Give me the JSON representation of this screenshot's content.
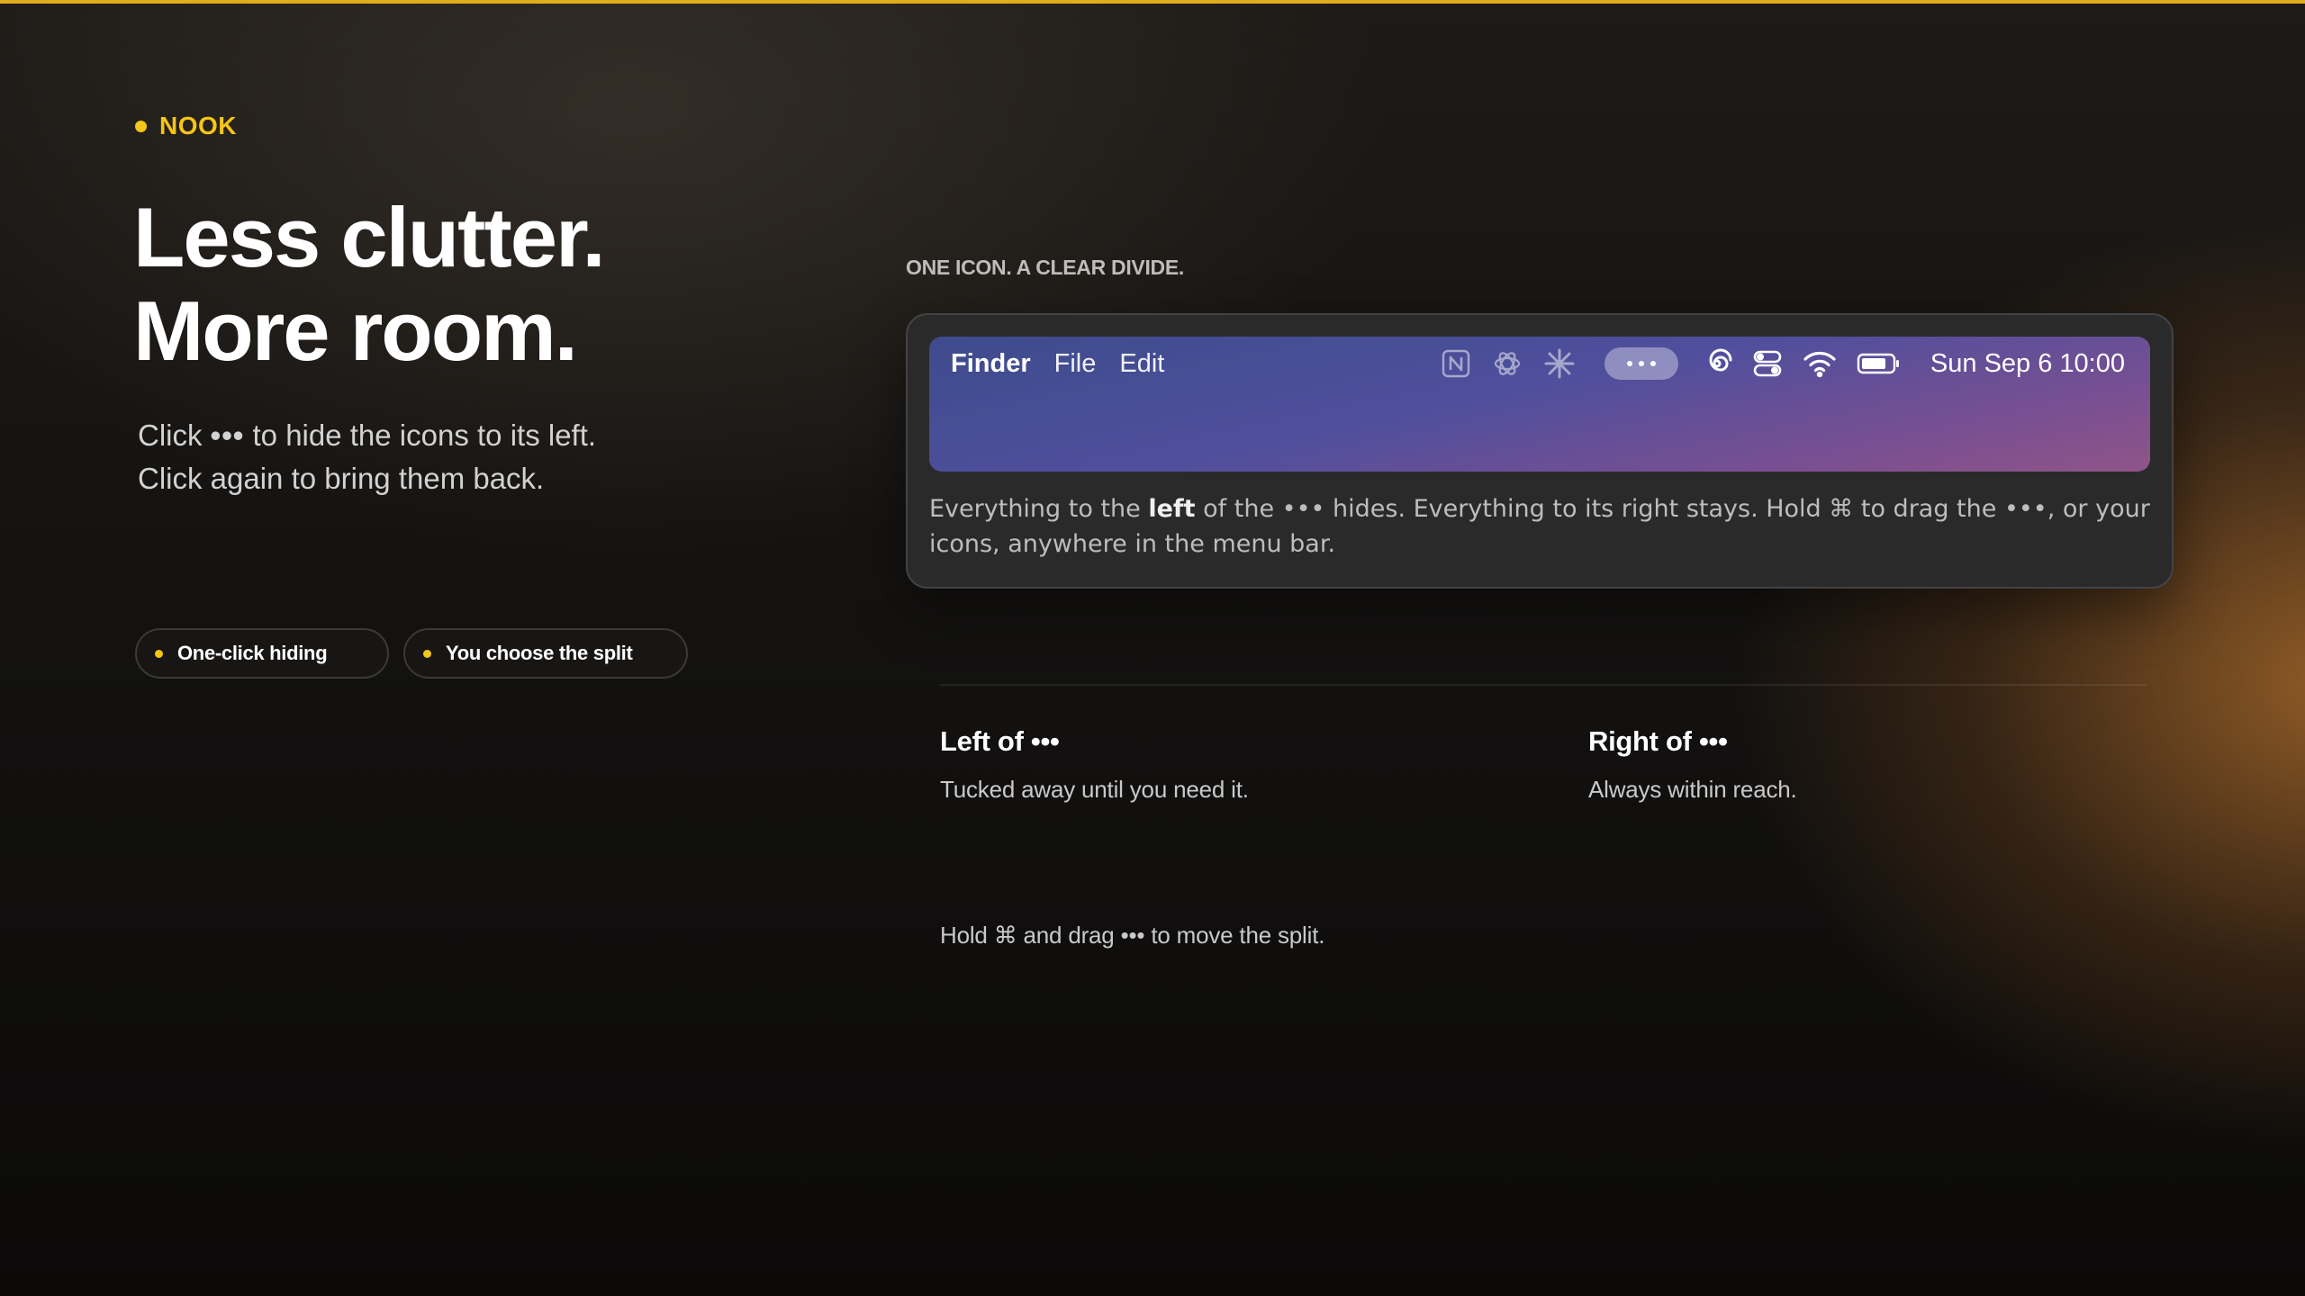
{
  "brand": {
    "label": "NOOK"
  },
  "hero": {
    "headline": [
      "Less clutter.",
      "More room."
    ],
    "sub_line1_pre": "Click",
    "sub_line1_ellipsis": "•••",
    "sub_line1_post": "to hide the icons to its left.",
    "sub_line2": "Click again to bring them back."
  },
  "pills": [
    {
      "label": "One-click hiding"
    },
    {
      "label": "You choose the split"
    }
  ],
  "demo": {
    "kicker": "ONE ICON. A CLEAR DIVIDE.",
    "menubar": {
      "app": "Finder",
      "menus": [
        "File",
        "Edit"
      ],
      "hidden_icons": [
        "notion-icon",
        "chatgpt-icon",
        "sparkle-icon"
      ],
      "toggle_label": "•••",
      "visible_icons": [
        "spiral-icon",
        "control-center-icon",
        "wifi-icon",
        "battery-icon"
      ],
      "clock": "Sun Sep 6 10:00"
    },
    "caption": {
      "t1": "Everything to the ",
      "bold": "left",
      "t2": " of the ••• hides. Everything to its right stays. Hold ⌘ to drag the •••, or your icons, anywhere in the menu bar."
    }
  },
  "columns": [
    {
      "title": "Left of •••",
      "subtitle": "Tucked away until you need it."
    },
    {
      "title": "Right of •••",
      "subtitle": "Always within reach."
    }
  ],
  "hint": "Hold ⌘ and drag ••• to move the split.",
  "colors": {
    "accent": "#f5c518",
    "menubar_start": "#3d4c8c",
    "menubar_end": "#8f5588"
  }
}
